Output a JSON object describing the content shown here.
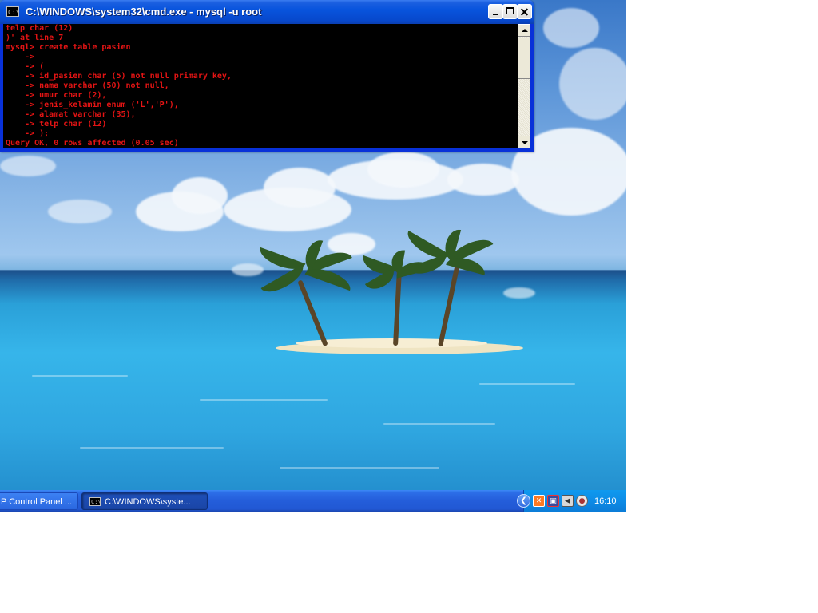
{
  "window": {
    "title": "C:\\WINDOWS\\system32\\cmd.exe - mysql -u root",
    "icon_label": "C:\\",
    "buttons": {
      "minimize": "minimize-icon",
      "maximize": "maximize-icon",
      "close": "close-icon"
    }
  },
  "console": {
    "text_color": "#e31414",
    "background": "#000000",
    "lines": [
      "telp char (12)",
      ")' at line 7",
      "mysql> create table pasien",
      "    -> ",
      "    -> (",
      "    -> id_pasien char (5) not null primary key,",
      "    -> nama varchar (50) not null,",
      "    -> umur char (2),",
      "    -> jenis_kelamin enum ('L','P'),",
      "    -> alamat varchar (35),",
      "    -> telp char (12)",
      "    -> );",
      "Query OK, 0 rows affected (0.05 sec)"
    ]
  },
  "taskbar": {
    "items": [
      {
        "label": "P Control Panel ..."
      },
      {
        "label": "C:\\WINDOWS\\syste...",
        "icon_label": "C:\\"
      }
    ],
    "tray": {
      "expand_glyph": "❮",
      "icons": [
        "xampp-icon",
        "network-icon",
        "speaker-icon",
        "update-icon"
      ],
      "clock": "16:10"
    }
  }
}
